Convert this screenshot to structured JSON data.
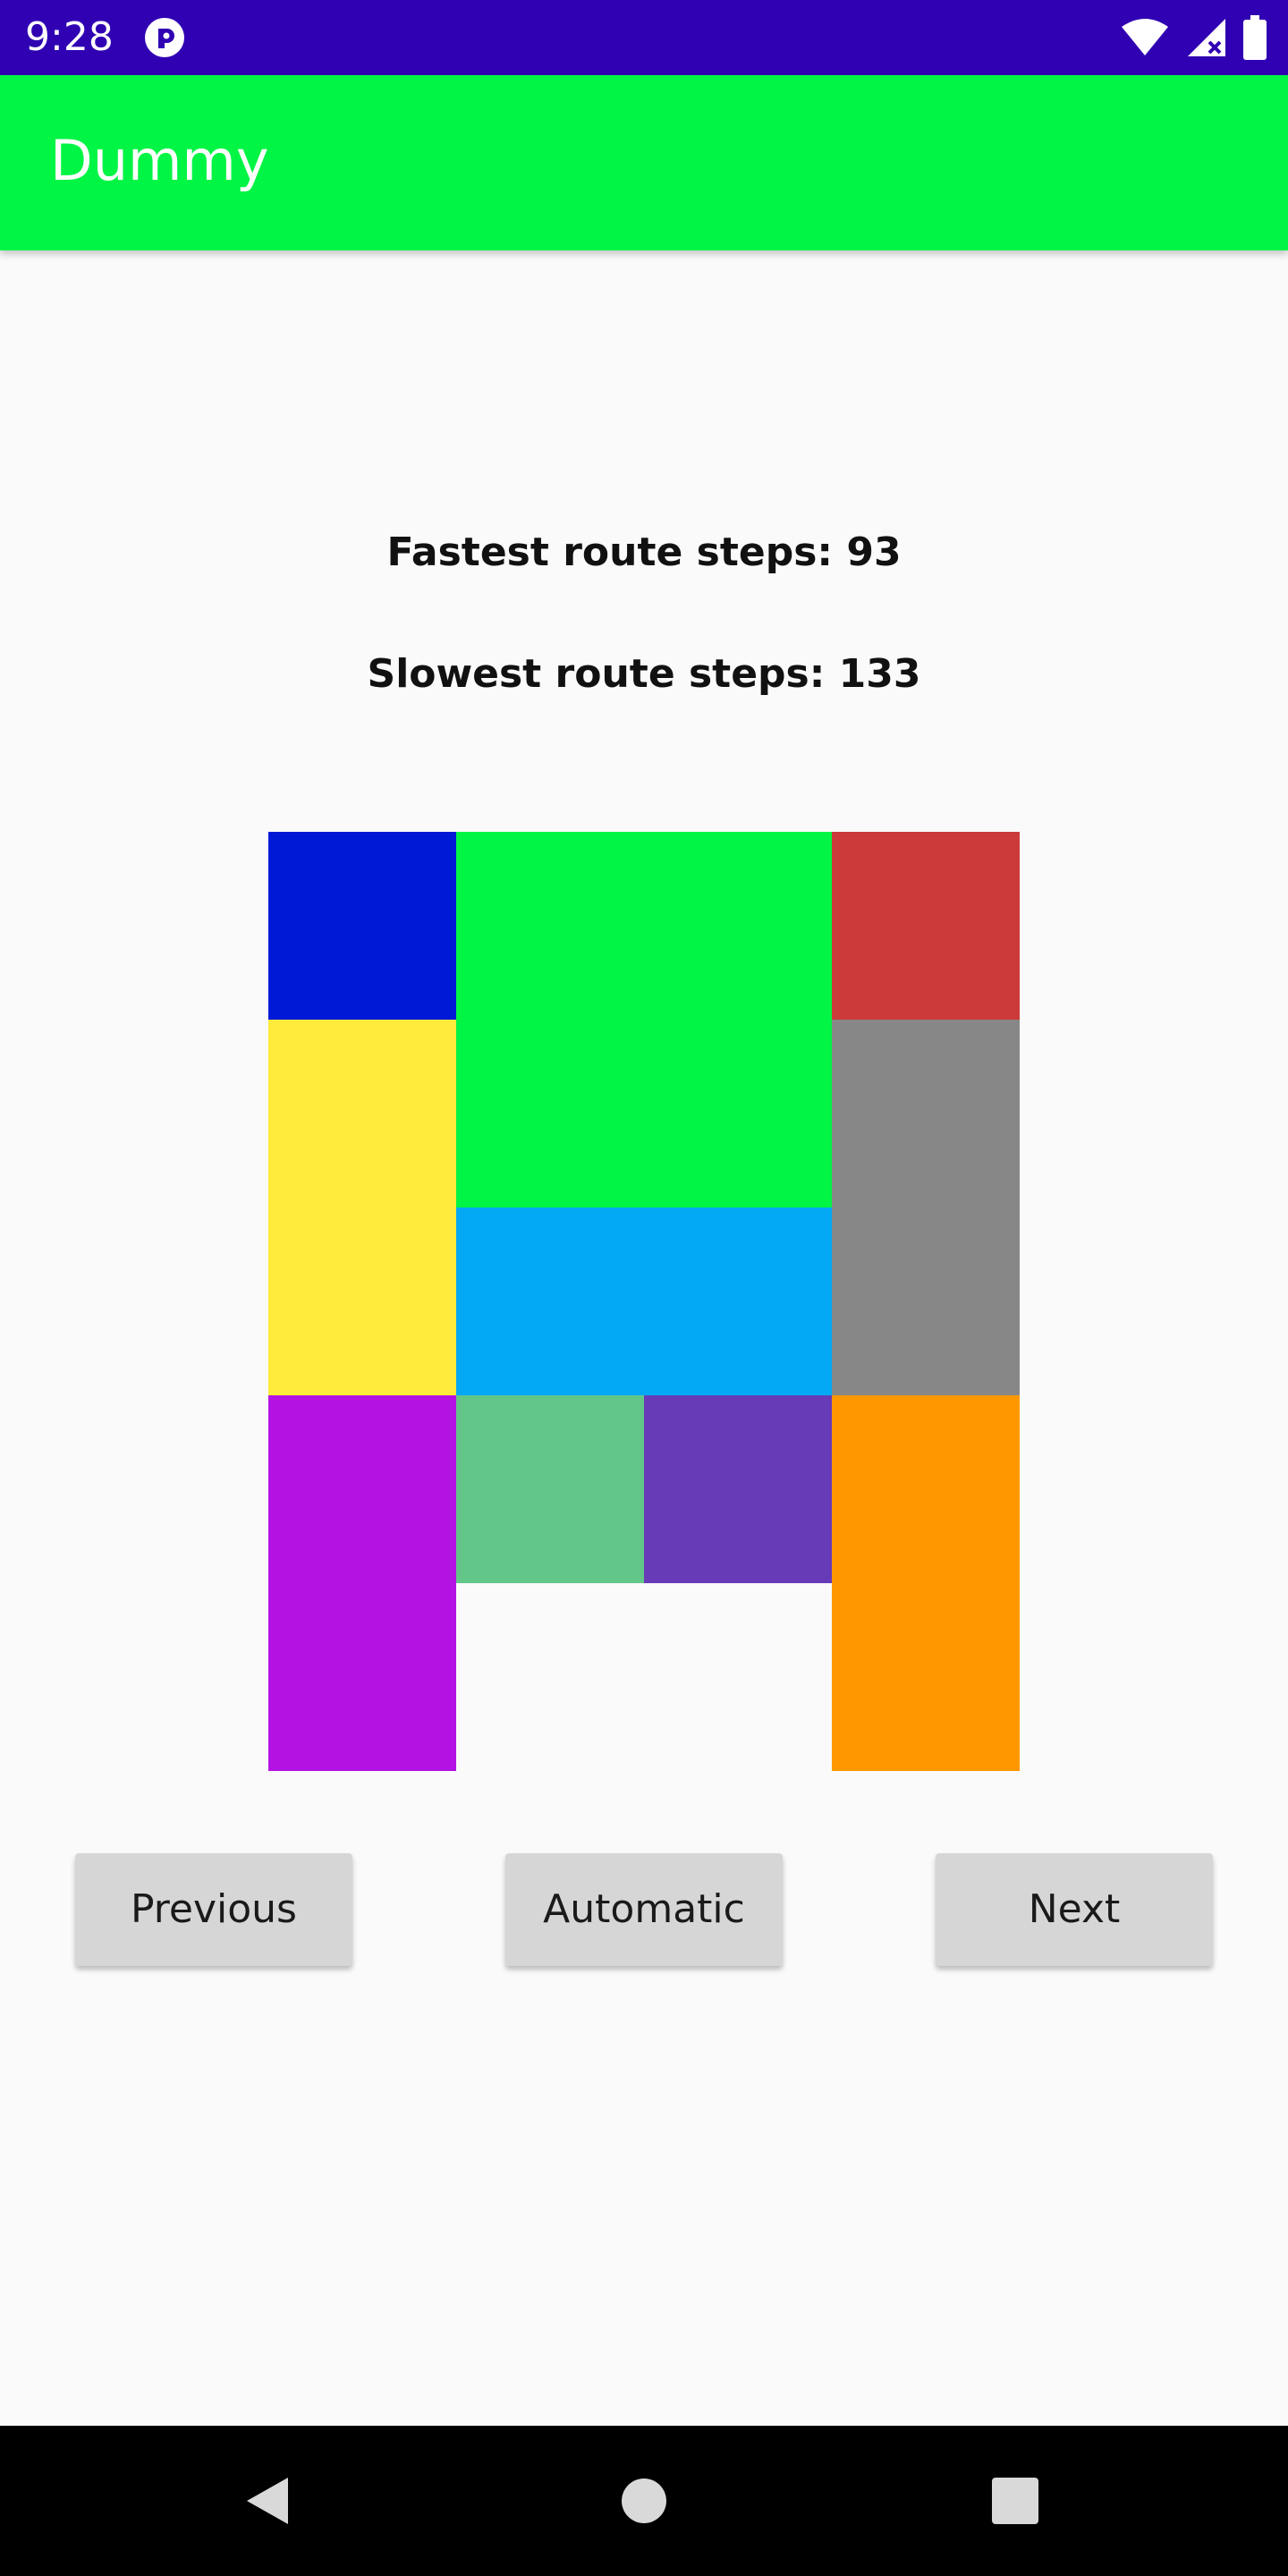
{
  "status_bar": {
    "time": "9:28",
    "icons": [
      "app-notification-icon",
      "wifi-icon",
      "cellular-signal-icon",
      "battery-icon"
    ],
    "background": "#3000b3"
  },
  "app_bar": {
    "title": "Dummy",
    "background": "#00f544"
  },
  "stats": {
    "fastest": "Fastest route steps: 93",
    "slowest": "Slowest route steps: 133"
  },
  "board": {
    "grid_columns": 4,
    "grid_rows": 5,
    "tiles": [
      {
        "name": "blue",
        "color": "#0019d6",
        "col": 0,
        "row": 0,
        "w": 1,
        "h": 1
      },
      {
        "name": "green",
        "color": "#00f544",
        "col": 1,
        "row": 0,
        "w": 2,
        "h": 2
      },
      {
        "name": "red",
        "color": "#cc3a3a",
        "col": 3,
        "row": 0,
        "w": 1,
        "h": 1
      },
      {
        "name": "yellow",
        "color": "#ffeb3b",
        "col": 0,
        "row": 1,
        "w": 1,
        "h": 2
      },
      {
        "name": "gray",
        "color": "#878787",
        "col": 3,
        "row": 1,
        "w": 1,
        "h": 2
      },
      {
        "name": "light-blue",
        "color": "#03a9f4",
        "col": 1,
        "row": 2,
        "w": 2,
        "h": 1
      },
      {
        "name": "purple",
        "color": "#b312e3",
        "col": 0,
        "row": 3,
        "w": 1,
        "h": 2
      },
      {
        "name": "mint-green",
        "color": "#63c689",
        "col": 1,
        "row": 3,
        "w": 1,
        "h": 1
      },
      {
        "name": "deep-purple",
        "color": "#673ab7",
        "col": 2,
        "row": 3,
        "w": 1,
        "h": 1
      },
      {
        "name": "orange",
        "color": "#ff9800",
        "col": 3,
        "row": 3,
        "w": 1,
        "h": 2
      }
    ]
  },
  "buttons": {
    "previous": "Previous",
    "automatic": "Automatic",
    "next": "Next"
  },
  "nav_bar": {
    "icons": [
      "back-icon",
      "home-icon",
      "recents-icon"
    ]
  }
}
